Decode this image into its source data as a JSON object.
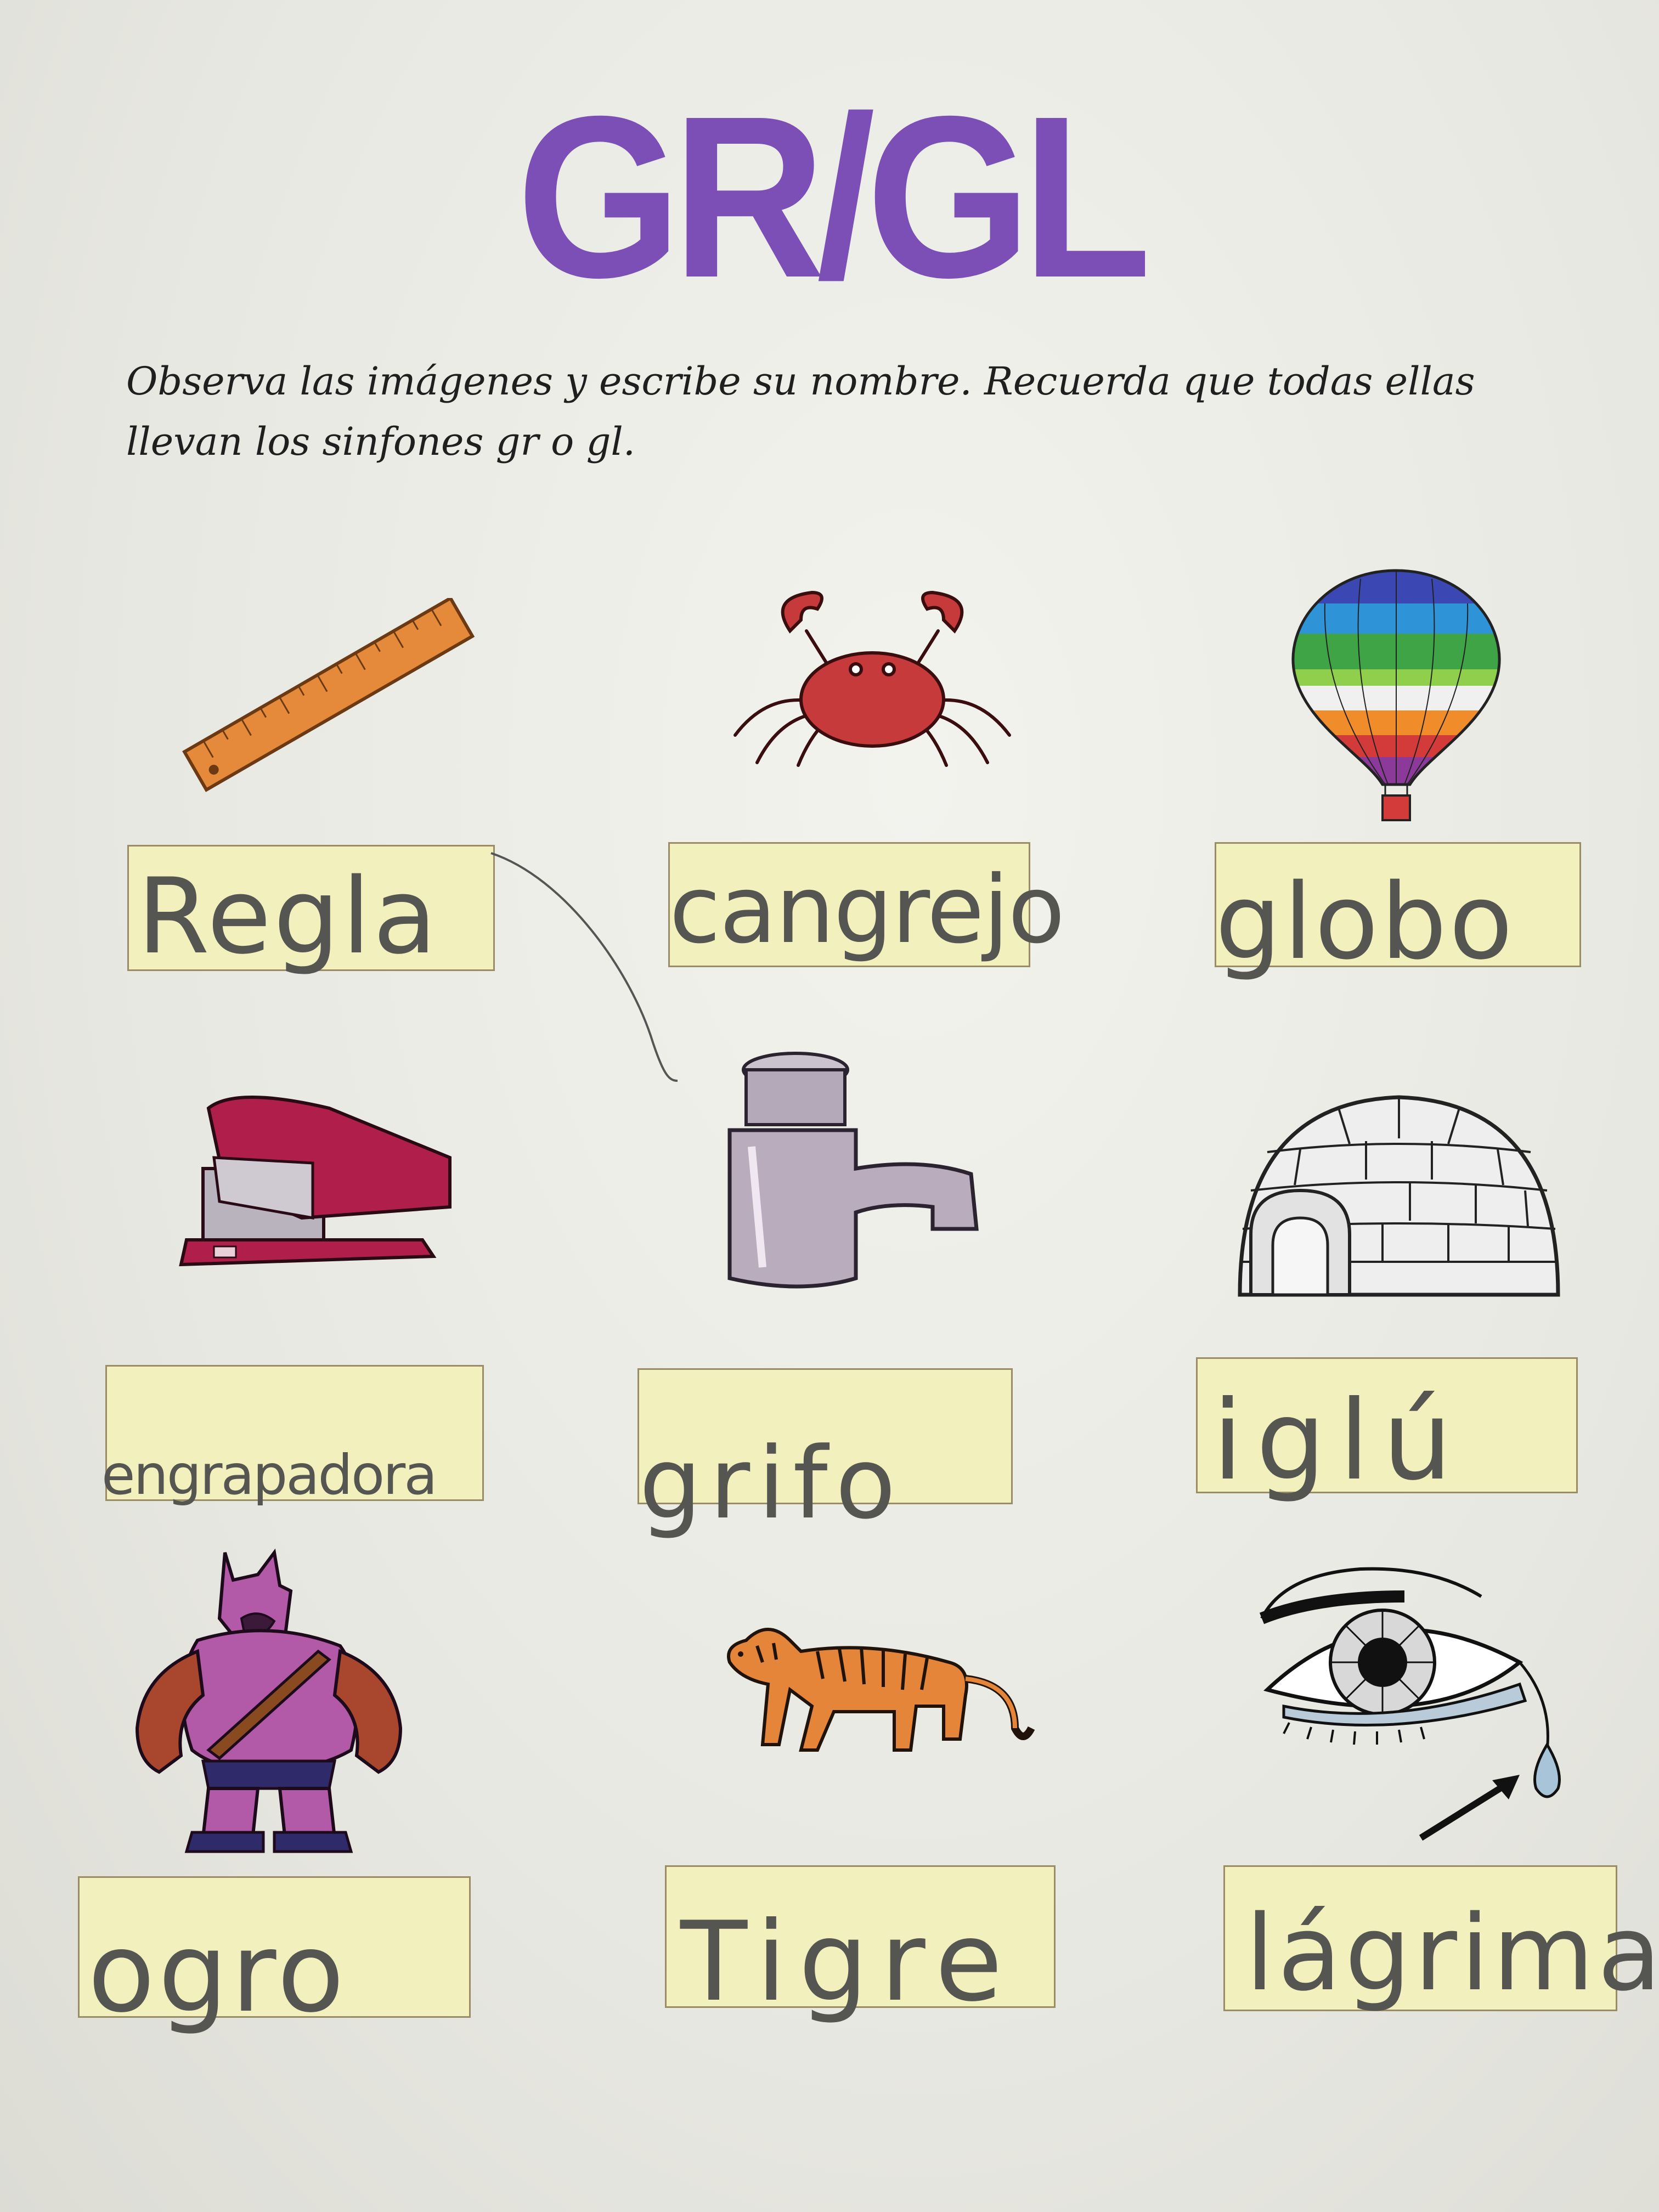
{
  "title": "GR/GL",
  "instructions": "Observa las imágenes y escribe su nombre. Recuerda que todas ellas llevan los sinfones  gr o gl.",
  "items": [
    {
      "picture": "ruler",
      "answer": "Regla"
    },
    {
      "picture": "crab",
      "answer": "cangrejo"
    },
    {
      "picture": "hot-air-balloon",
      "answer": "globo"
    },
    {
      "picture": "stapler",
      "answer": "engrapadora"
    },
    {
      "picture": "faucet",
      "answer": "grifo"
    },
    {
      "picture": "igloo",
      "answer": "iglú"
    },
    {
      "picture": "ogre",
      "answer": "ogro"
    },
    {
      "picture": "tiger",
      "answer": "Tigre"
    },
    {
      "picture": "teardrop-eye",
      "answer": "lágrima"
    }
  ]
}
